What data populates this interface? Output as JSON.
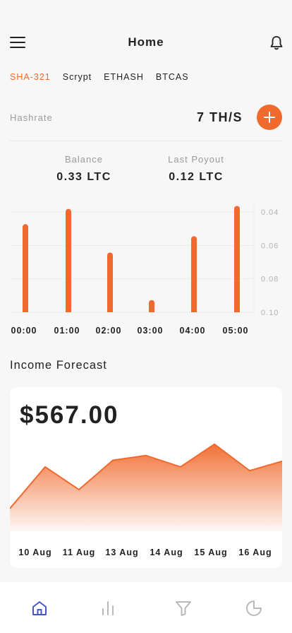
{
  "header": {
    "title": "Home",
    "menu_icon": "hamburger-menu-icon",
    "notification_icon": "bell-icon"
  },
  "algo_tabs": [
    {
      "label": "SHA-321",
      "active": true
    },
    {
      "label": "Scrypt",
      "active": false
    },
    {
      "label": "ETHASH",
      "active": false
    },
    {
      "label": "BTCAS",
      "active": false
    }
  ],
  "hashrate": {
    "label": "Hashrate",
    "value": "7 TH/S",
    "add_icon": "plus-icon"
  },
  "stats": {
    "balance": {
      "label": "Balance",
      "value": "0.33 LTC"
    },
    "last_payout": {
      "label": "Last Poyout",
      "value": "0.12 LTC"
    }
  },
  "accent_color": "#f06a2d",
  "income": {
    "title": "Income Forecast",
    "amount": "$567.00"
  },
  "nav": [
    {
      "name": "home-icon",
      "active": true
    },
    {
      "name": "bar-chart-icon",
      "active": false
    },
    {
      "name": "filter-icon",
      "active": false
    },
    {
      "name": "pie-chart-icon",
      "active": false
    }
  ],
  "chart_data": [
    {
      "type": "bar",
      "categories": [
        "00:00",
        "01:00",
        "02:00",
        "03:00",
        "04:00",
        "05:00"
      ],
      "values": [
        0.0473,
        0.0382,
        0.0643,
        0.0927,
        0.0545,
        0.0364
      ],
      "y_ticks": [
        "0.04",
        "0.06",
        "0.08",
        "0.10"
      ],
      "ylim": [
        0.03,
        0.1
      ],
      "y_axis_side": "right",
      "grid": true
    },
    {
      "type": "area",
      "categories": [
        "10 Aug",
        "11 Aug",
        "13 Aug",
        "14 Aug",
        "15 Aug",
        "16 Aug"
      ],
      "values": [
        24,
        68,
        44,
        75,
        80,
        68,
        92,
        64,
        74
      ],
      "ylim": [
        0,
        100
      ],
      "grid": false
    }
  ]
}
